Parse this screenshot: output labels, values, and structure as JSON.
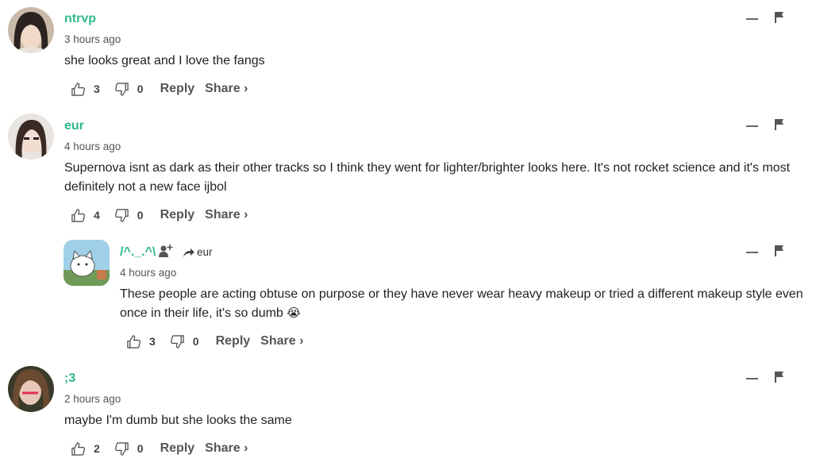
{
  "comments": [
    {
      "username": "ntrvp",
      "time": "3 hours ago",
      "text": "she looks great and I love the fangs",
      "likes": "3",
      "dislikes": "0",
      "reply_label": "Reply",
      "share_label": "Share ›"
    },
    {
      "username": "eur",
      "time": "4 hours ago",
      "text": "Supernova isnt as dark as their other tracks so I think they went for lighter/brighter looks here. It's not rocket science and it's most definitely not a new face ijbol",
      "likes": "4",
      "dislikes": "0",
      "reply_label": "Reply",
      "share_label": "Share ›"
    },
    {
      "username": "/^._.^\\",
      "reply_to": "eur",
      "time": "4 hours ago",
      "text": "These people are acting obtuse on purpose or they have never wear heavy makeup or tried a different makeup style even once in their life, it's so dumb",
      "emoji": "😭",
      "likes": "3",
      "dislikes": "0",
      "reply_label": "Reply",
      "share_label": "Share ›"
    },
    {
      "username": ";3",
      "time": "2 hours ago",
      "text": "maybe I'm dumb but she looks the same",
      "likes": "2",
      "dislikes": "0",
      "reply_label": "Reply",
      "share_label": "Share ›"
    }
  ],
  "colors": {
    "username": "#2fb88a",
    "text": "#222222",
    "muted": "#555555"
  },
  "icons": [
    "thumbs-up-icon",
    "thumbs-down-icon",
    "minimize-icon",
    "flag-icon",
    "follow-user-icon",
    "reply-arrow-icon"
  ]
}
